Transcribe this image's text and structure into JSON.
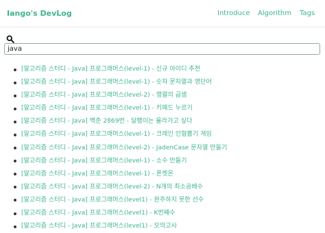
{
  "header": {
    "brand": "Iango's DevLog",
    "nav": [
      {
        "label": "Introduce"
      },
      {
        "label": "Algorithm"
      },
      {
        "label": "Tags"
      }
    ]
  },
  "search": {
    "icon": "search-icon",
    "value": "java"
  },
  "results": [
    {
      "title": "[알고리즘 스터디 - Java] 프로그래머스(level-1) - 신규 아이디 추천"
    },
    {
      "title": "[알고리즘 스터디 - Java] 프로그래머스(level-1) - 숫자 문자열과 영단어"
    },
    {
      "title": "[알고리즘 스터디 - Java] 프로그래머스(level-2) - 행렬의 곱셈"
    },
    {
      "title": "[알고리즘 스터디 - Java] 프로그래머스(level-1) - 키패드 누르기"
    },
    {
      "title": "[알고리즘 스터디 - Java] 백준 2869번 - 달팽이는 올라가고 싶다"
    },
    {
      "title": "[알고리즘 스터디 - Java] 프로그래머스(level-1) - 크레인 인형뽑기 게임"
    },
    {
      "title": "[알고리즘 스터디 - Java] 프로그래머스(level-2) - JadenCase 문자열 만들기"
    },
    {
      "title": "[알고리즘 스터디 - Java] 프로그래머스(level-1) - 소수 만들기"
    },
    {
      "title": "[알고리즘 스터디 - Java] 프로그래머스(level-1) - 폰켓몬"
    },
    {
      "title": "[알고리즘 스터디 - Java] 프로그래머스(level-2) - N개의 최소공배수"
    },
    {
      "title": "[알고리즘 스터디 - Java] 프로그래머스(level1) - 완주하지 못한 선수"
    },
    {
      "title": "[알고리즘 스터디 - Java] 프로그래머스(level1) - K번째수"
    },
    {
      "title": "[알고리즘 스터디 - Java] 프로그래머스(level1) - 모의고사"
    }
  ],
  "colors": {
    "accent": "#3cb48e",
    "bullet": "#333333",
    "input_border": "#8fa89c"
  }
}
